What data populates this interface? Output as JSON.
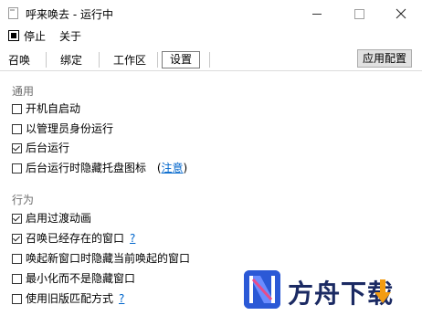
{
  "window": {
    "title": "呼来唤去 - 运行中"
  },
  "menu": {
    "stop": "停止",
    "about": "关于"
  },
  "tabs": [
    {
      "label": "召唤"
    },
    {
      "label": "绑定"
    },
    {
      "label": "工作区"
    },
    {
      "label": "设置"
    }
  ],
  "active_tab": "设置",
  "apply_button": "应用配置",
  "sections": {
    "general": {
      "title": "通用",
      "items": [
        {
          "label": "开机自启动",
          "checked": false
        },
        {
          "label": "以管理员身份运行",
          "checked": false
        },
        {
          "label": "后台运行",
          "checked": true
        },
        {
          "label": "后台运行时隐藏托盘图标",
          "checked": false,
          "note_open": "(",
          "note_link": "注意",
          "note_close": ")"
        }
      ]
    },
    "behavior": {
      "title": "行为",
      "items": [
        {
          "label": "启用过渡动画",
          "checked": true
        },
        {
          "label": "召唤已经存在的窗口",
          "checked": true,
          "help": "?"
        },
        {
          "label": "唤起新窗口时隐藏当前唤起的窗口",
          "checked": false
        },
        {
          "label": "最小化而不是隐藏窗口",
          "checked": false
        },
        {
          "label": "使用旧版匹配方式",
          "checked": false,
          "help": "?"
        }
      ]
    }
  },
  "watermark": {
    "text": "方舟下载"
  },
  "colors": {
    "link": "#0066cc",
    "section_title": "#6d6d6d",
    "watermark_logo": "#2b59d6",
    "watermark_text": "#1b2a63",
    "watermark_arrow": "#f39c12"
  }
}
